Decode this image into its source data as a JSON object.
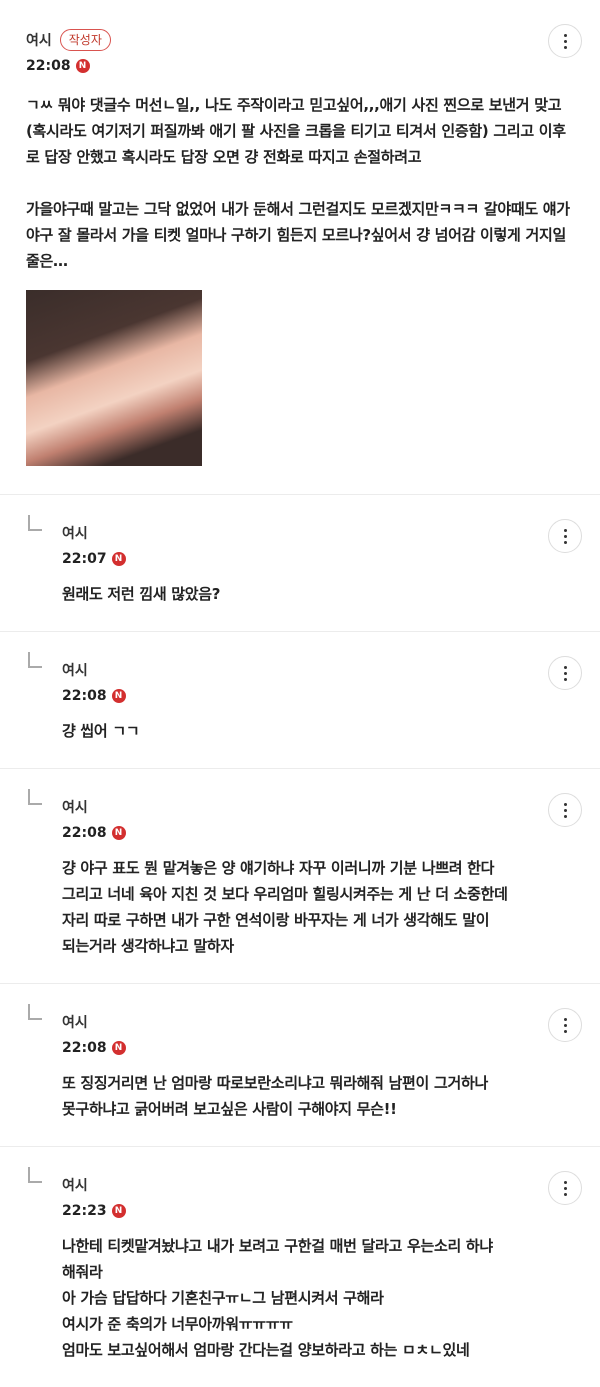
{
  "post": {
    "author": "여시",
    "author_badge": "작성자",
    "time": "22:08",
    "new_badge": "N",
    "body": "ㄱㅆ 뭐야 댓글수 머선ㄴ일,, 나도 주작이라고 믿고싶어,,,애기 사진 찐으로 보낸거 맞고(혹시라도 여기저기 퍼질까봐 애기 팔 사진을 크롭을 티기고 티겨서 인증함) 그리고 이후로 답장 안했고 혹시라도 답장 오면 걍 전화로 따지고 손절하려고\n\n가을야구때 말고는 그닥 없었어 내가 둔해서 그런걸지도 모르겠지만ㅋㅋㅋ 갈야때도 얘가 야구 잘 몰라서 가을 티켓 얼마나 구하기 힘든지 모르나?싶어서 걍 넘어감 이렇게 거지일줄은…"
  },
  "comments": [
    {
      "author": "여시",
      "time": "22:07",
      "new_badge": "N",
      "body": "원래도 저런 낌새 많았음?"
    },
    {
      "author": "여시",
      "time": "22:08",
      "new_badge": "N",
      "body": "걍 씹어 ㄱㄱ"
    },
    {
      "author": "여시",
      "time": "22:08",
      "new_badge": "N",
      "body": "걍 야구 표도 뭔 맡겨놓은 양 얘기하냐 자꾸 이러니까 기분 나쁘려 한다\n그리고 너네 육아 지친 것 보다 우리엄마 힐링시켜주는 게 난 더 소중한데\n자리 따로 구하면 내가 구한 연석이랑 바꾸자는 게 너가 생각해도 말이\n되는거라 생각하냐고 말하자"
    },
    {
      "author": "여시",
      "time": "22:08",
      "new_badge": "N",
      "body": "또 징징거리면 난 엄마랑 따로보란소리냐고 뭐라해줘 남편이 그거하나\n못구하냐고 긁어버려 보고싶은 사람이 구해야지 무슨!!"
    },
    {
      "author": "여시",
      "time": "22:23",
      "new_badge": "N",
      "body": "나한테 티켓맡겨놨냐고 내가 보려고 구한걸 매번 달라고 우는소리 하냐\n해줘라\n아 가슴 답답하다 기혼친구ㅠㄴ그 남편시켜서 구해라\n여시가 준 축의가 너무아까워ㅠㅠㅠㅠ\n엄마도 보고싶어해서 엄마랑 간다는걸 양보하라고 하는 ㅁㅊㄴ있네"
    }
  ]
}
